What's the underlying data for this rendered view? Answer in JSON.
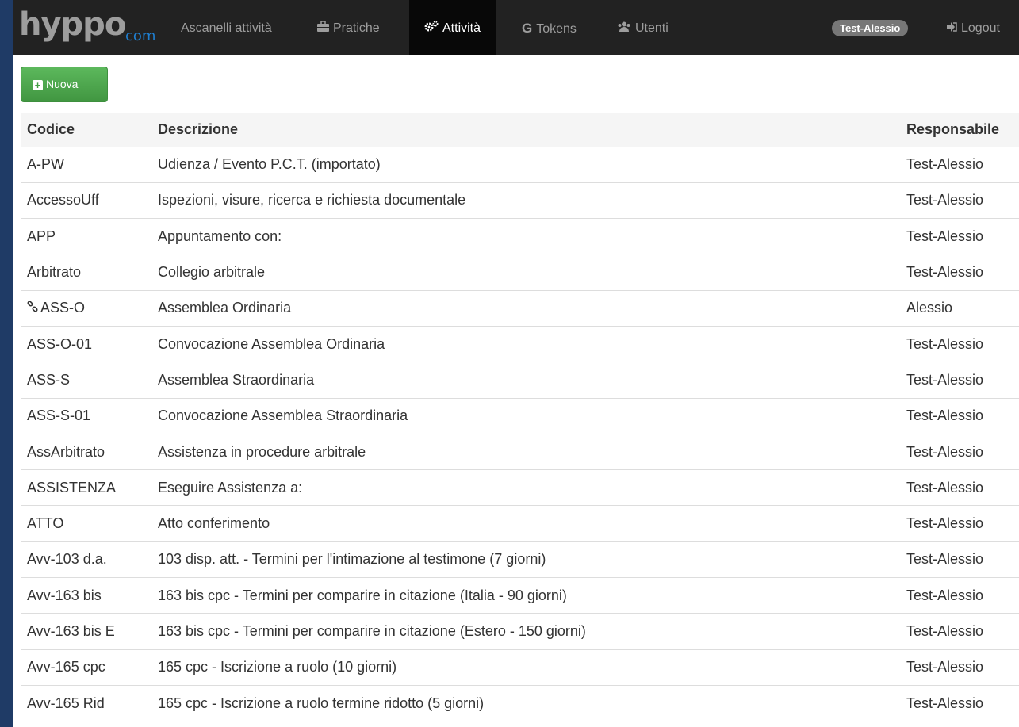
{
  "brand": {
    "main": "hyppo",
    "sub": "com"
  },
  "nav": {
    "items": [
      {
        "label": "Ascanelli attività",
        "icon": ""
      },
      {
        "label": "Pratiche",
        "icon": "briefcase-icon"
      },
      {
        "label": "Attività",
        "icon": "gears-icon"
      },
      {
        "label": "Tokens",
        "icon": "google-icon"
      },
      {
        "label": "Utenti",
        "icon": "users-icon"
      }
    ],
    "user": "Test-Alessio",
    "logout": "Logout"
  },
  "toolbar": {
    "new_label": "Nuova"
  },
  "table": {
    "headers": {
      "code": "Codice",
      "description": "Descrizione",
      "owner": "Responsabile"
    },
    "rows": [
      {
        "code": "A-PW",
        "description": "Udienza / Evento P.C.T. (importato)",
        "owner": "Test-Alessio"
      },
      {
        "code": "AccessoUff",
        "description": "Ispezioni, visure, ricerca e richiesta documentale",
        "owner": "Test-Alessio"
      },
      {
        "code": "APP",
        "description": "Appuntamento con:",
        "owner": "Test-Alessio"
      },
      {
        "code": "Arbitrato",
        "description": "Collegio arbitrale",
        "owner": "Test-Alessio"
      },
      {
        "code": "ASS-O",
        "description": "Assemblea Ordinaria",
        "owner": "Alessio",
        "linked": true
      },
      {
        "code": "ASS-O-01",
        "description": "Convocazione Assemblea Ordinaria",
        "owner": "Test-Alessio"
      },
      {
        "code": "ASS-S",
        "description": "Assemblea Straordinaria",
        "owner": "Test-Alessio"
      },
      {
        "code": "ASS-S-01",
        "description": "Convocazione Assemblea Straordinaria",
        "owner": "Test-Alessio"
      },
      {
        "code": "AssArbitrato",
        "description": "Assistenza in procedure arbitrale",
        "owner": "Test-Alessio"
      },
      {
        "code": "ASSISTENZA",
        "description": "Eseguire Assistenza a:",
        "owner": "Test-Alessio"
      },
      {
        "code": "ATTO",
        "description": "Atto conferimento",
        "owner": "Test-Alessio"
      },
      {
        "code": "Avv-103 d.a.",
        "description": "103 disp. att. - Termini per l'intimazione al testimone (7 giorni)",
        "owner": "Test-Alessio"
      },
      {
        "code": "Avv-163 bis",
        "description": "163 bis cpc - Termini per comparire in citazione (Italia - 90 giorni)",
        "owner": "Test-Alessio"
      },
      {
        "code": "Avv-163 bis E",
        "description": "163 bis cpc - Termini per comparire in citazione (Estero - 150 giorni)",
        "owner": "Test-Alessio"
      },
      {
        "code": "Avv-165 cpc",
        "description": "165 cpc - Iscrizione a ruolo (10 giorni)",
        "owner": "Test-Alessio"
      },
      {
        "code": "Avv-165 Rid",
        "description": "165 cpc - Iscrizione a ruolo termine ridotto (5 giorni)",
        "owner": "Test-Alessio"
      }
    ]
  }
}
